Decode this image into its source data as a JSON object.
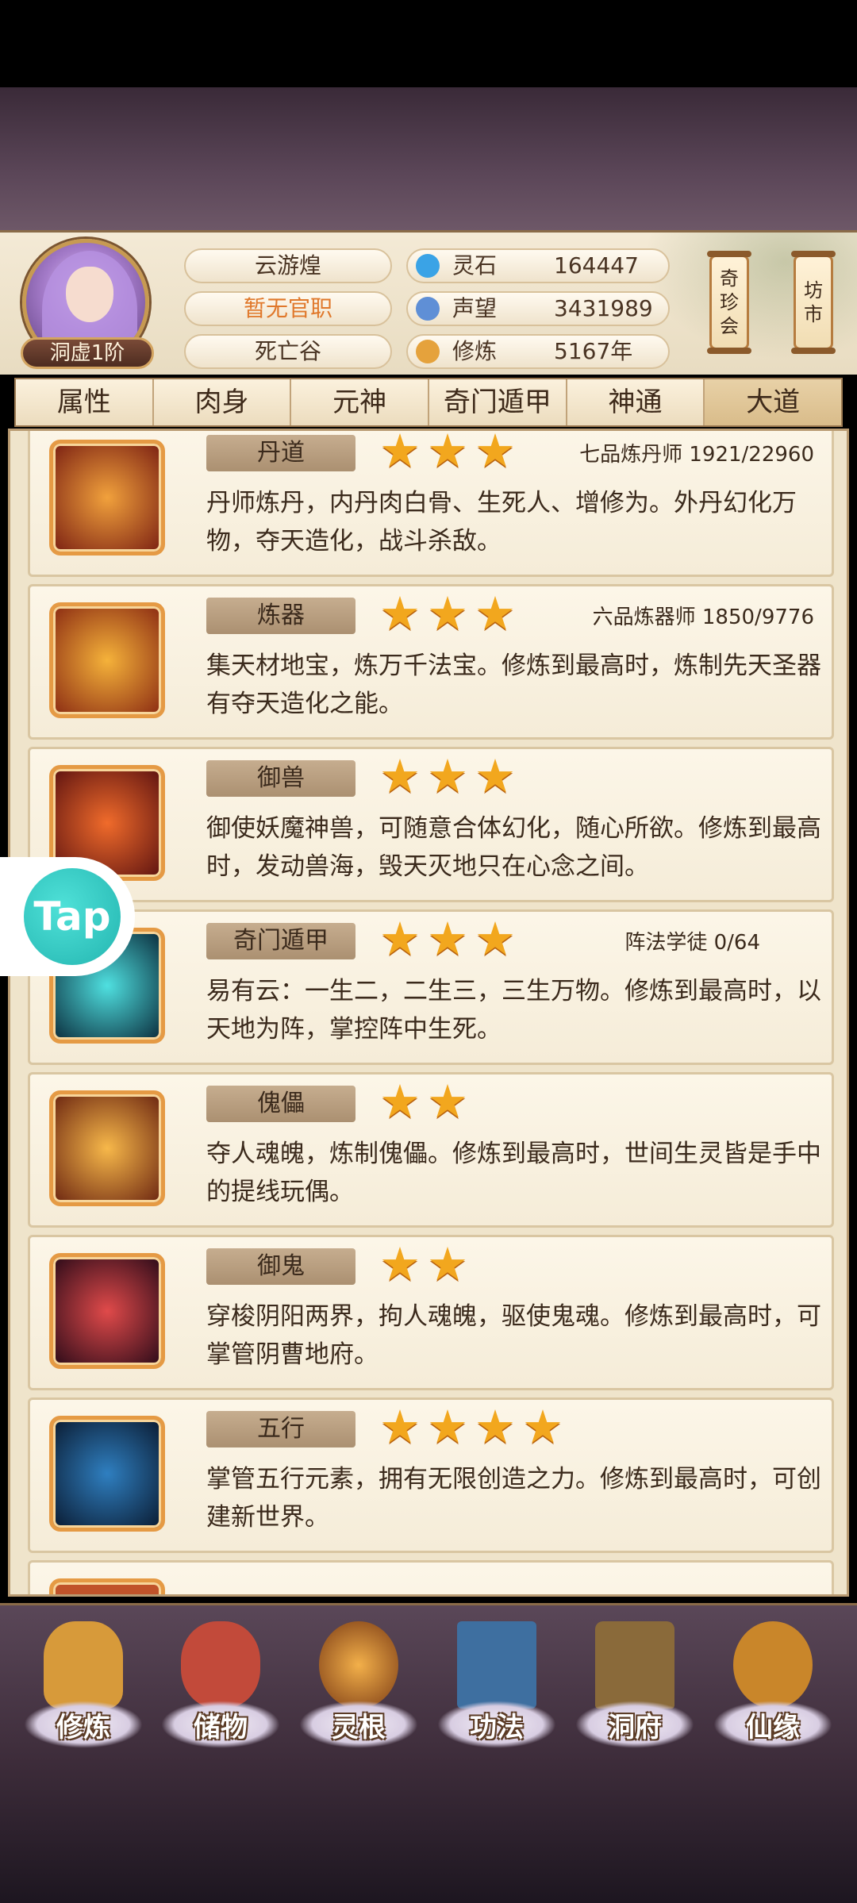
{
  "player": {
    "name": "云游煌",
    "official_title": "暂无官职",
    "location": "死亡谷",
    "realm": "洞虚1阶"
  },
  "resources": [
    {
      "label": "灵石",
      "value": "164447",
      "icon": "spirit-stone-icon",
      "color": "#3aa3e6"
    },
    {
      "label": "声望",
      "value": "3431989",
      "icon": "prestige-crystal-icon",
      "color": "#5f8fd6"
    },
    {
      "label": "修炼",
      "value": "5167年",
      "icon": "meditation-icon",
      "color": "#e5a23c"
    }
  ],
  "side_buttons": {
    "treasure": "奇珍会",
    "market": "坊市"
  },
  "tabs": [
    "属性",
    "肉身",
    "元神",
    "奇门遁甲",
    "神通",
    "大道"
  ],
  "active_tab": "大道",
  "daos": [
    {
      "title": "丹道",
      "stars": 3,
      "rank": "七品炼丹师 1921/22960",
      "desc": "丹师炼丹，内丹肉白骨、生死人、增修为。外丹幻化万物，夺天造化，战斗杀敌。",
      "icon_color": "#c8421e"
    },
    {
      "title": "炼器",
      "stars": 3,
      "rank": "六品炼器师 1850/9776",
      "desc": "集天材地宝，炼万千法宝。修炼到最高时，炼制先天圣器有夺天造化之能。",
      "icon_color": "#d06a1a"
    },
    {
      "title": "御兽",
      "stars": 3,
      "rank": "",
      "desc": "御使妖魔神兽，可随意合体幻化，随心所欲。修炼到最高时，发动兽海，毁天灭地只在心念之间。",
      "icon_color": "#b22a16"
    },
    {
      "title": "奇门遁甲",
      "stars": 3,
      "rank": "阵法学徒 0/64",
      "desc": "易有云：一生二，二生三，三生万物。修炼到最高时，以天地为阵，掌控阵中生死。",
      "icon_color": "#1c7a86"
    },
    {
      "title": "傀儡",
      "stars": 2,
      "rank": "",
      "desc": "夺人魂魄，炼制傀儡。修炼到最高时，世间生灵皆是手中的提线玩偶。",
      "icon_color": "#d7741c"
    },
    {
      "title": "御鬼",
      "stars": 2,
      "rank": "",
      "desc": "穿梭阴阳两界，拘人魂魄，驱使鬼魂。修炼到最高时，可掌管阴曹地府。",
      "icon_color": "#7a1f2c"
    },
    {
      "title": "五行",
      "stars": 4,
      "rank": "",
      "desc": "掌管五行元素，拥有无限创造之力。修炼到最高时，可创建新世界。",
      "icon_color": "#1d6fa8"
    }
  ],
  "tap_badge": "Tap",
  "bottom_nav": [
    {
      "label": "修炼",
      "icon": "cultivate-icon",
      "color": "#d79a3a"
    },
    {
      "label": "储物",
      "icon": "storage-bag-icon",
      "color": "#c24a3a"
    },
    {
      "label": "灵根",
      "icon": "spirit-root-icon",
      "color": "#b87528"
    },
    {
      "label": "功法",
      "icon": "technique-book-icon",
      "color": "#3e6fa0"
    },
    {
      "label": "洞府",
      "icon": "cave-abode-icon",
      "color": "#8a6a3a"
    },
    {
      "label": "仙缘",
      "icon": "immortal-fate-icon",
      "color": "#c9862a"
    }
  ]
}
